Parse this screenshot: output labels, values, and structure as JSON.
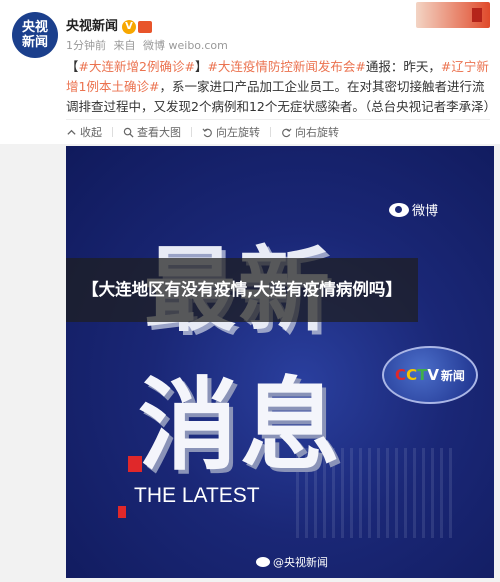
{
  "post": {
    "avatar_text": [
      "央视",
      "新闻"
    ],
    "author": "央视新闻",
    "verified_badge": "V",
    "meta": {
      "time": "1分钟前",
      "source_prefix": "来自",
      "source": "微博 weibo.com"
    },
    "body": {
      "tag1": "#大连新增2例确诊#",
      "bracket_open": "【",
      "bracket_close": "】",
      "tag2": "#大连疫情防控新闻发布会#",
      "text1": "通报：昨天，",
      "tag3": "#辽宁新增1例本土确诊#",
      "text2": "，系一家进口产品加工企业员工。在对其密切接触者进行流调排查过程中，又发现2个病例和12个无症状感染者。（总台央视记者李承泽）"
    }
  },
  "toolbar": {
    "collapse_label": "收起",
    "view_large_label": "查看大图",
    "rotate_left_label": "向左旋转",
    "rotate_right_label": "向右旋转"
  },
  "image": {
    "headline_line1": "最新",
    "headline_line2": "消息",
    "subtitle": "THE LATEST",
    "weibo_mark": "微博",
    "cctv_logo": [
      "C",
      "C",
      "T",
      "V",
      "新闻"
    ],
    "watermark": "@央视新闻"
  },
  "overlay_title": "【大连地区有没有疫情,大连有疫情病例吗】",
  "colors": {
    "accent": "#eb7350",
    "image_bg": "#1a2776",
    "cctv_red": "#e0282a"
  }
}
